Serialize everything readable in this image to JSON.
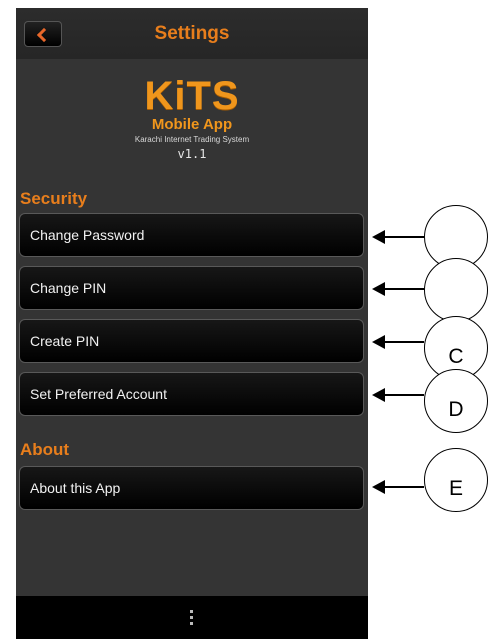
{
  "header": {
    "title": "Settings"
  },
  "logo": {
    "main": "KiTS",
    "sub": "Mobile App",
    "tagline": "Karachi Internet Trading System",
    "version": "v1.1"
  },
  "security": {
    "heading": "Security",
    "items": [
      {
        "label": "Change Password"
      },
      {
        "label": "Change PIN"
      },
      {
        "label": "Create PIN"
      },
      {
        "label": "Set Preferred Account"
      }
    ]
  },
  "about": {
    "heading": "About",
    "items": [
      {
        "label": "About this App"
      }
    ]
  },
  "annotations": [
    "",
    "",
    "C",
    "D",
    "E"
  ],
  "colors": {
    "accent": "#e87e1c",
    "background": "#343434",
    "button": "#000000"
  },
  "icons": {
    "back": "chevron-left-icon",
    "menu": "overflow-menu-icon"
  }
}
